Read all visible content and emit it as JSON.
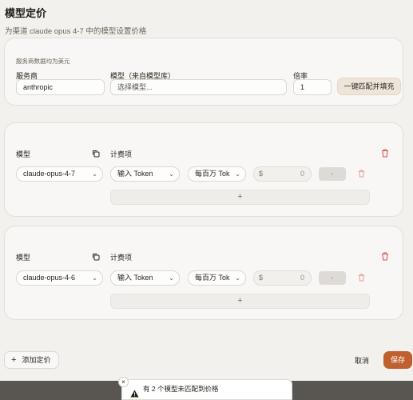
{
  "dialog": {
    "title": "模型定价",
    "subtitle": "为渠道 claude opus 4-7 中的模型设置价格"
  },
  "provider_section": {
    "note": "服务商数据均为美元",
    "provider_label": "服务商",
    "provider_value": "anthropic",
    "model_label": "模型（来自模型库）",
    "model_placeholder": "选择模型...",
    "rate_label": "倍率",
    "rate_value": "1",
    "fill_button": "一键匹配并填充"
  },
  "model_cards": [
    {
      "model_label": "模型",
      "billing_label": "计费项",
      "model_value": "claude-opus-4-7",
      "billing_item": "输入 Token",
      "unit": "每百万 Tok",
      "currency": "$",
      "price_placeholder": "0",
      "dash": "-",
      "add": "+"
    },
    {
      "model_label": "模型",
      "billing_label": "计费项",
      "model_value": "claude-opus-4-6",
      "billing_item": "输入 Token",
      "unit": "每百万 Tok",
      "currency": "$",
      "price_placeholder": "0",
      "dash": "-",
      "add": "+"
    }
  ],
  "footer": {
    "add_pricing": "添加定价",
    "add_plus": "+",
    "cancel": "取消",
    "save": "保存"
  },
  "toast": {
    "message": "有 2 个模型未匹配到价格",
    "close": "×"
  },
  "colors": {
    "accent": "#c0602f",
    "danger": "#d9534f",
    "background": "#f3f1ed"
  }
}
